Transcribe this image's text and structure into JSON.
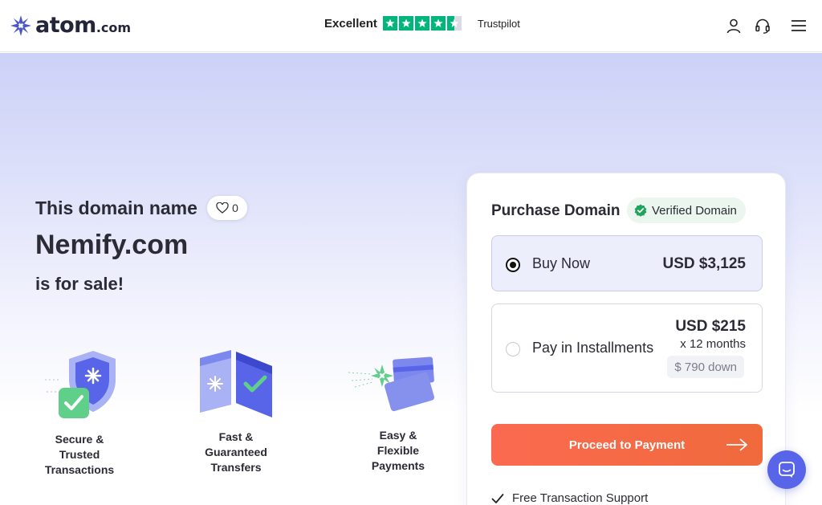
{
  "header": {
    "logo_text": "atom",
    "logo_tld": ".com",
    "trust_word": "Excellent",
    "trust_rating_stars": 4.5,
    "trust_brand": "Trustpilot",
    "icons": [
      "user-icon",
      "headset-icon",
      "menu-icon"
    ]
  },
  "hero": {
    "line1": "This domain name",
    "favorite_count": "0",
    "domain": "Nemify.com",
    "line3": "is for sale!"
  },
  "features": [
    {
      "label_lines": [
        "Secure &",
        "Trusted",
        "Transactions"
      ]
    },
    {
      "label_lines": [
        "Fast &",
        "Guaranteed",
        "Transfers"
      ]
    },
    {
      "label_lines": [
        "Easy &",
        "Flexible",
        "Payments"
      ]
    }
  ],
  "purchase": {
    "title": "Purchase Domain",
    "verified_label": "Verified Domain",
    "options": [
      {
        "label": "Buy Now",
        "price": "USD $3,125",
        "selected": true
      },
      {
        "label": "Pay in Installments",
        "price": "USD $215",
        "term": "x 12 months",
        "down": "$ 790 down",
        "selected": false
      }
    ],
    "cta": "Proceed to Payment",
    "perks": [
      "Free Transaction Support"
    ]
  },
  "colors": {
    "accent": "#5865e8",
    "cta": "#f46a45",
    "trustpilot_green": "#00b67a",
    "verified_green": "#22a35a"
  }
}
